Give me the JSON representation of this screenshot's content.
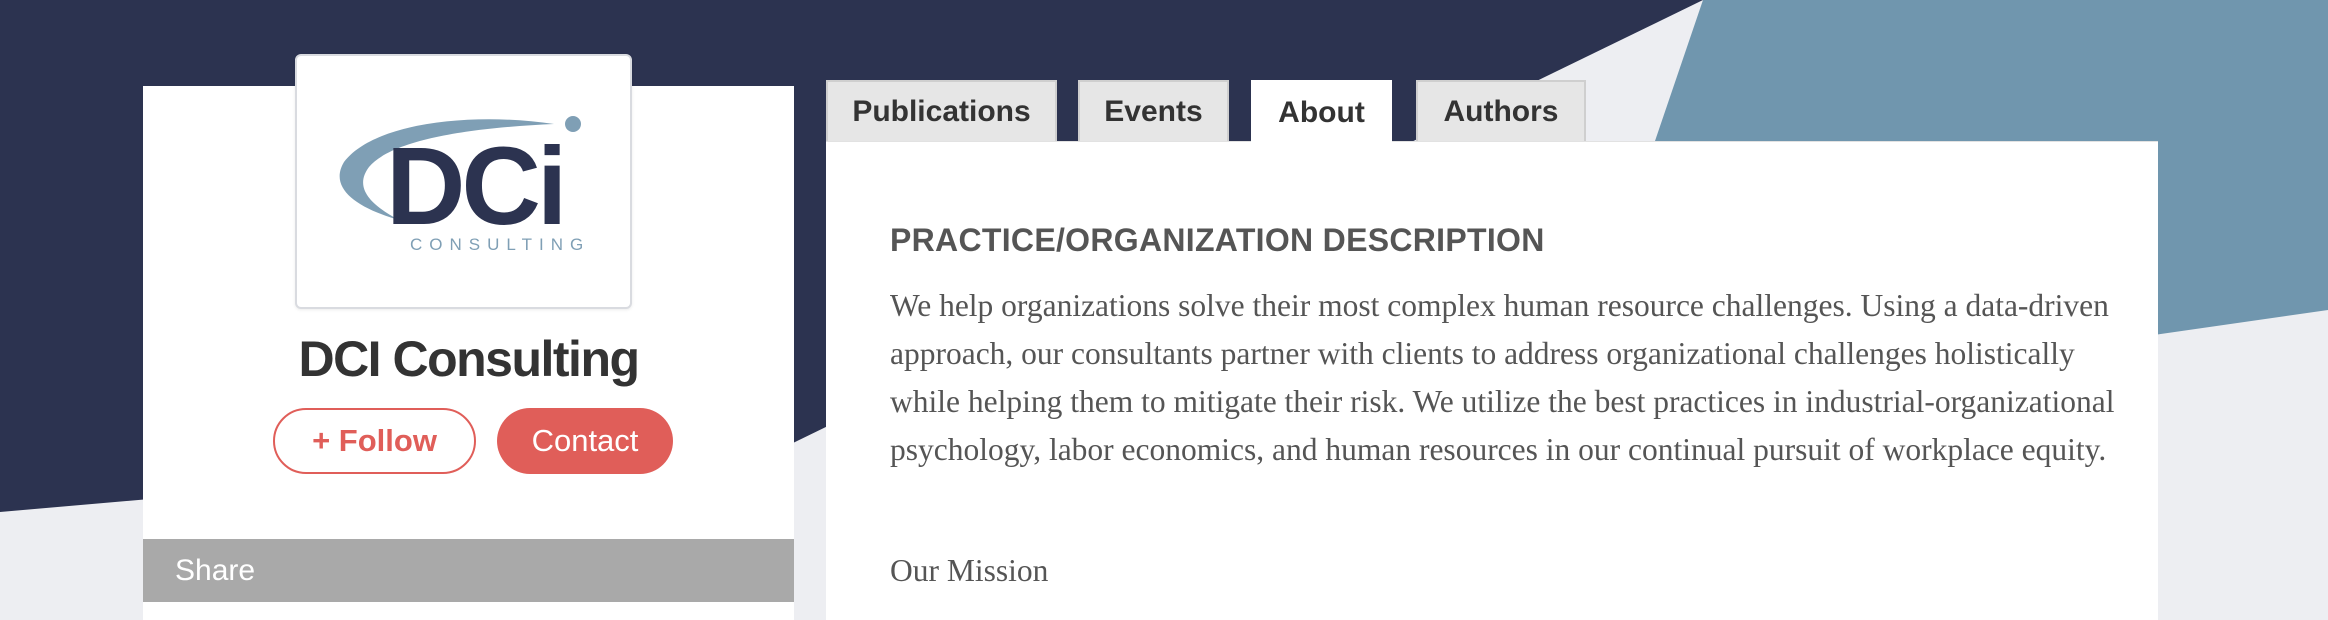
{
  "profile": {
    "logo": {
      "wordmark": "DCi",
      "subtext": "CONSULTING"
    },
    "name": "DCI Consulting",
    "follow_label": "+ Follow",
    "contact_label": "Contact",
    "share_label": "Share"
  },
  "tabs": [
    {
      "label": "Publications",
      "active": false
    },
    {
      "label": "Events",
      "active": false
    },
    {
      "label": "About",
      "active": true
    },
    {
      "label": "Authors",
      "active": false
    }
  ],
  "about": {
    "heading": "PRACTICE/ORGANIZATION DESCRIPTION",
    "description": "We help organizations solve their most complex human resource challenges. Using a data-driven approach, our consultants partner with clients to address organizational challenges holistically while helping them to mitigate their risk. We utilize the best practices in industrial-organizational psychology, labor economics, and human resources in our continual pursuit of workplace equity.",
    "subheading": "Our Mission"
  },
  "colors": {
    "navy_background": "#2c3350",
    "steel_blue_background": "#7096ae",
    "light_background": "#edeef2",
    "accent_red": "#e05e59",
    "share_bar": "#a9a9a9",
    "logo_navy": "#2c3350",
    "logo_swoosh": "#7f9fb5"
  }
}
